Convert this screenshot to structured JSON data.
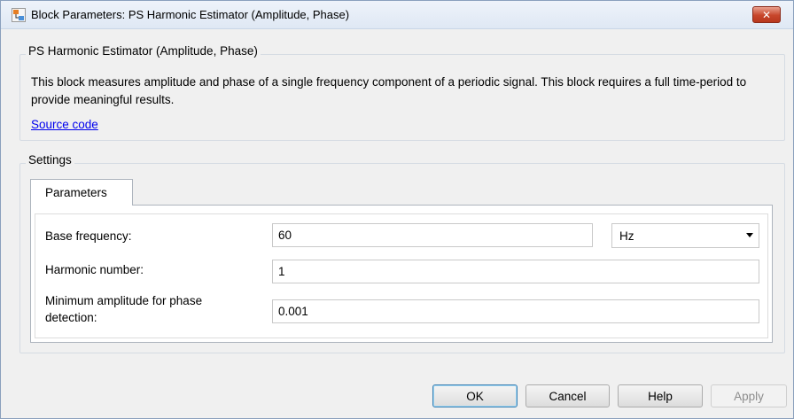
{
  "window": {
    "title": "Block Parameters: PS Harmonic Estimator (Amplitude, Phase)",
    "close_label": "✕"
  },
  "block": {
    "group_title": "PS Harmonic Estimator (Amplitude, Phase)",
    "description": "This block measures amplitude and phase of a single frequency component of a periodic signal. This block requires a full time-period to provide meaningful results.",
    "source_link": "Source code"
  },
  "settings": {
    "group_title": "Settings",
    "tab_label": "Parameters",
    "params": {
      "base_frequency": {
        "label": "Base frequency:",
        "value": "60",
        "unit": "Hz"
      },
      "harmonic_number": {
        "label": "Harmonic number:",
        "value": "1"
      },
      "min_amplitude": {
        "label_line1": "Minimum amplitude for phase",
        "label_line2": "detection:",
        "value": "0.001"
      }
    }
  },
  "buttons": {
    "ok": "OK",
    "cancel": "Cancel",
    "help": "Help",
    "apply": "Apply"
  },
  "icons": {
    "title": "simulink-block-icon",
    "close": "close-icon",
    "dropdown": "chevron-down-icon"
  }
}
